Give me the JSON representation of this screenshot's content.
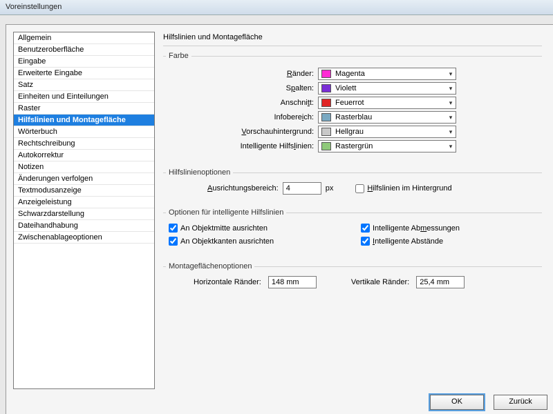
{
  "window": {
    "title": "Voreinstellungen"
  },
  "sidebar": {
    "items": [
      "Allgemein",
      "Benutzeroberfläche",
      "Eingabe",
      "Erweiterte Eingabe",
      "Satz",
      "Einheiten und Einteilungen",
      "Raster",
      "Hilfslinien und Montagefläche",
      "Wörterbuch",
      "Rechtschreibung",
      "Autokorrektur",
      "Notizen",
      "Änderungen verfolgen",
      "Textmodusanzeige",
      "Anzeigeleistung",
      "Schwarzdarstellung",
      "Dateihandhabung",
      "Zwischenablageoptionen"
    ],
    "selected": 7
  },
  "main": {
    "heading": "Hilfslinien und Montagefläche",
    "farbe": {
      "legend": "Farbe",
      "rows": [
        {
          "label_pre": "",
          "label_u": "R",
          "label_post": "änder:",
          "swatch": "#ff2ad4",
          "value": "Magenta"
        },
        {
          "label_pre": "S",
          "label_u": "p",
          "label_post": "alten:",
          "swatch": "#7a2ed6",
          "value": "Violett"
        },
        {
          "label_pre": "Anschni",
          "label_u": "t",
          "label_post": "t:",
          "swatch": "#e02424",
          "value": "Feuerrot"
        },
        {
          "label_pre": "Infobere",
          "label_u": "i",
          "label_post": "ch:",
          "swatch": "#7aa9c2",
          "value": "Rasterblau"
        },
        {
          "label_pre": "",
          "label_u": "V",
          "label_post": "orschauhintergrund:",
          "swatch": "#c8c8c8",
          "value": "Hellgrau"
        },
        {
          "label_pre": "Intelligente Hilfs",
          "label_u": "l",
          "label_post": "inien:",
          "swatch": "#8fc97a",
          "value": "Rastergrün"
        }
      ]
    },
    "guides": {
      "legend": "Hilfslinienoptionen",
      "align_label_pre": "",
      "align_label_u": "A",
      "align_label_post": "usrichtungsbereich:",
      "align_value": "4",
      "align_unit": "px",
      "back_label_pre": "",
      "back_label_u": "H",
      "back_label_post": "ilfslinien im Hintergrund",
      "back_checked": false
    },
    "smart": {
      "legend": "Optionen für intelligente Hilfslinien",
      "opts": [
        {
          "pre": "An Objektmitte ausrichten",
          "u": "",
          "post": "",
          "checked": true
        },
        {
          "pre": "Intelligente Ab",
          "u": "m",
          "post": "essungen",
          "checked": true
        },
        {
          "pre": "An Objektkanten ausrichten",
          "u": "",
          "post": "",
          "checked": true
        },
        {
          "pre": "",
          "u": "I",
          "post": "ntelligente Abstände",
          "checked": true
        }
      ]
    },
    "paste": {
      "legend": "Montageflächenoptionen",
      "h_label": "Horizontale Ränder:",
      "h_value": "148 mm",
      "v_label": "Vertikale Ränder:",
      "v_value": "25,4 mm"
    }
  },
  "footer": {
    "ok": "OK",
    "back": "Zurück"
  }
}
